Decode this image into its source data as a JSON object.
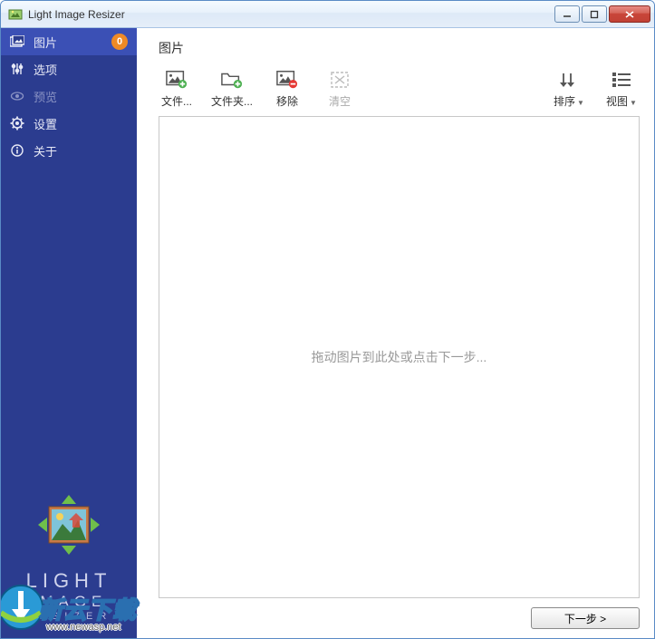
{
  "window": {
    "title": "Light Image Resizer"
  },
  "sidebar": {
    "items": [
      {
        "label": "图片",
        "badge": "0"
      },
      {
        "label": "选项"
      },
      {
        "label": "预览"
      },
      {
        "label": "设置"
      },
      {
        "label": "关于"
      }
    ],
    "brand_line1": "LIGHT",
    "brand_line2": "IMAGE",
    "brand_line3": "RESIZER"
  },
  "main": {
    "title": "图片",
    "toolbar": {
      "add_file": "文件...",
      "add_folder": "文件夹...",
      "remove": "移除",
      "clear": "清空",
      "sort": "排序",
      "view": "视图"
    },
    "dropzone_hint": "拖动图片到此处或点击下一步...",
    "next_button": "下一步 >"
  },
  "watermark": {
    "text": "新云下载",
    "sub": "www.newasp.net"
  }
}
